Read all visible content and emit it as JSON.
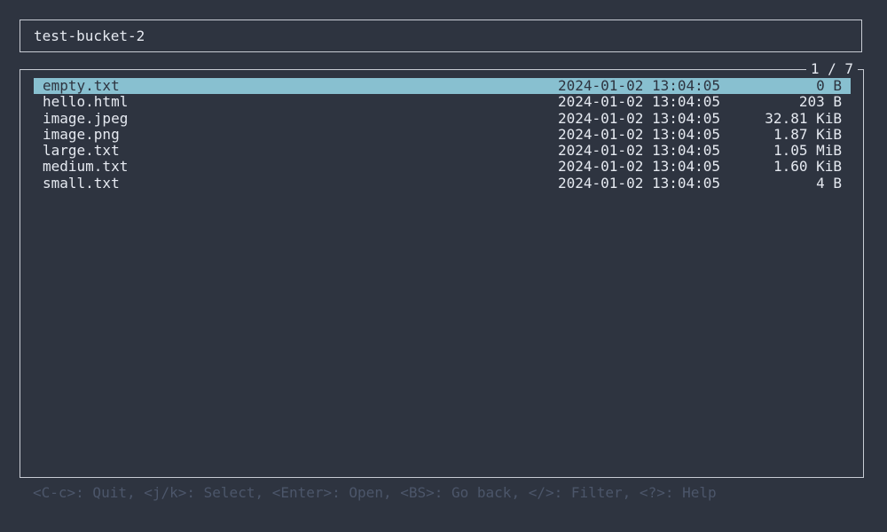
{
  "header": {
    "title": "test-bucket-2"
  },
  "list": {
    "counter": "1 / 7",
    "rows": [
      {
        "name": "empty.txt",
        "date": "2024-01-02 13:04:05",
        "size": "0 B"
      },
      {
        "name": "hello.html",
        "date": "2024-01-02 13:04:05",
        "size": "203 B"
      },
      {
        "name": "image.jpeg",
        "date": "2024-01-02 13:04:05",
        "size": "32.81 KiB"
      },
      {
        "name": "image.png",
        "date": "2024-01-02 13:04:05",
        "size": "1.87 KiB"
      },
      {
        "name": "large.txt",
        "date": "2024-01-02 13:04:05",
        "size": "1.05 MiB"
      },
      {
        "name": "medium.txt",
        "date": "2024-01-02 13:04:05",
        "size": "1.60 KiB"
      },
      {
        "name": "small.txt",
        "date": "2024-01-02 13:04:05",
        "size": "4 B"
      }
    ]
  },
  "footer": {
    "help": "<C-c>: Quit, <j/k>: Select, <Enter>: Open, <BS>: Go back, </>: Filter, <?>: Help"
  },
  "colors": {
    "background": "#2e3440",
    "foreground": "#e5e9f0",
    "border": "#c8ccd4",
    "selection": "#88c0d0",
    "help_text": "#4c566a"
  }
}
